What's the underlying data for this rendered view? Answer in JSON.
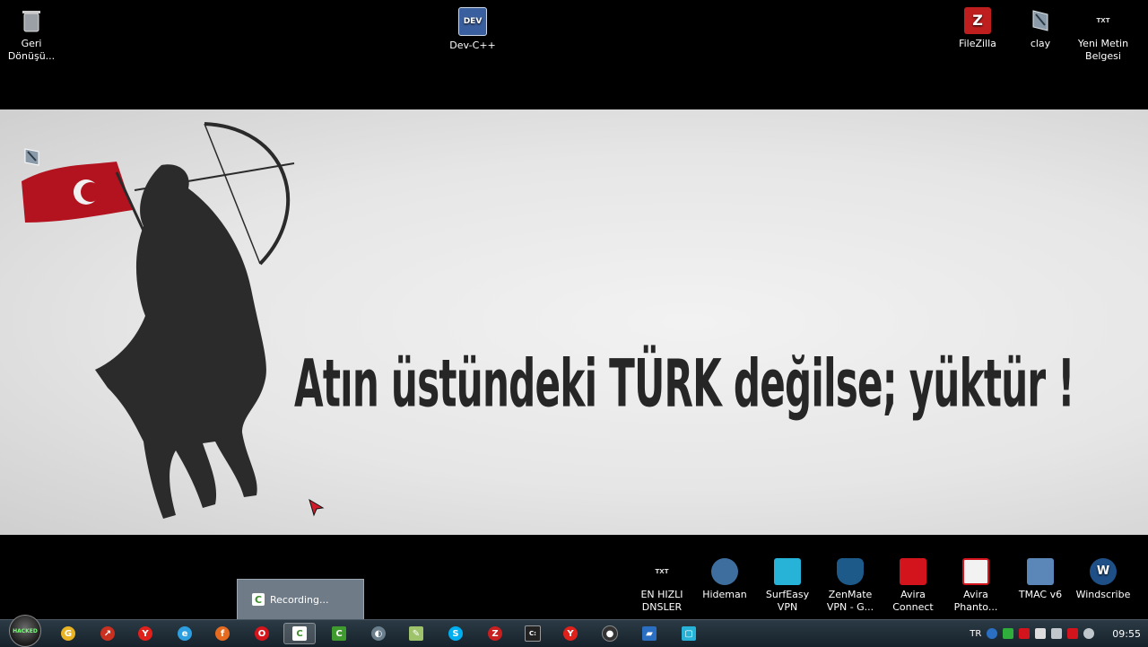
{
  "desktop_top_icons": [
    {
      "name": "recycle-bin",
      "label": "Geri\nDönüşü...",
      "icon": "trash-icon",
      "color": "#9aa0a6"
    },
    {
      "name": "dev-cpp",
      "label": "Dev-C++",
      "icon": "devcpp-icon",
      "color": "#3a5f9e",
      "glyph": "DEV"
    },
    {
      "name": "filezilla",
      "label": "FileZilla",
      "icon": "filezilla-icon",
      "color": "#bf1e1e",
      "glyph": "Z"
    },
    {
      "name": "clay",
      "label": "clay",
      "icon": "file-icon",
      "color": "#8a9aa8"
    },
    {
      "name": "yeni-metin-belgesi",
      "label": "Yeni Metin\nBelgesi",
      "icon": "text-file-icon",
      "color": "#e8e8e8",
      "glyph": "TXT"
    }
  ],
  "banner": {
    "slogan": "Atın üstündeki TÜRK değilse; yüktür !"
  },
  "desktop_bottom_icons": [
    {
      "name": "en-hizli-dnsler",
      "label": "EN HIZLI\nDNSLER",
      "icon": "text-file-icon",
      "color": "#d9d9d9",
      "glyph": "TXT"
    },
    {
      "name": "hideman",
      "label": "Hideman",
      "icon": "hideman-icon",
      "color": "#3d6e9e"
    },
    {
      "name": "surfeasy-vpn",
      "label": "SurfEasy VPN",
      "icon": "surfeasy-icon",
      "color": "#27b3d8"
    },
    {
      "name": "zenmate-vpn",
      "label": "ZenMate\nVPN - G...",
      "icon": "zenmate-icon",
      "color": "#1d5a8a"
    },
    {
      "name": "avira-connect",
      "label": "Avira\nConnect",
      "icon": "avira-icon",
      "color": "#d3141c"
    },
    {
      "name": "avira-phantom",
      "label": "Avira\nPhanto...",
      "icon": "avira-phantom-icon",
      "color": "#f2f2f2"
    },
    {
      "name": "tmac-v6",
      "label": "TMAC v6",
      "icon": "tmac-icon",
      "color": "#5a86b8"
    },
    {
      "name": "windscribe",
      "label": "Windscribe",
      "icon": "windscribe-icon",
      "color": "#1e4f86",
      "glyph": "W"
    }
  ],
  "recording_popup": {
    "label": "Recording..."
  },
  "taskbar": {
    "start_label": "HACKED",
    "apps": [
      {
        "name": "chrome",
        "color": "#e9b323",
        "glyph": "G"
      },
      {
        "name": "app-red",
        "color": "#c9301f",
        "glyph": "↗"
      },
      {
        "name": "yandex",
        "color": "#e0201b",
        "glyph": "Y"
      },
      {
        "name": "ie",
        "color": "#2d9fe0",
        "glyph": "e"
      },
      {
        "name": "firefox",
        "color": "#e66b1f",
        "glyph": "f"
      },
      {
        "name": "opera",
        "color": "#d6141c",
        "glyph": "O"
      },
      {
        "name": "camtasia-active",
        "color": "#ffffff",
        "glyph": "C",
        "active": true
      },
      {
        "name": "camtasia",
        "color": "#3f9b2e",
        "glyph": "C"
      },
      {
        "name": "steam",
        "color": "#6a7e8c",
        "glyph": "◐"
      },
      {
        "name": "notepad",
        "color": "#9ec36a",
        "glyph": "✎"
      },
      {
        "name": "skype",
        "color": "#00aff0",
        "glyph": "S"
      },
      {
        "name": "filezilla-task",
        "color": "#c81f1f",
        "glyph": "Z"
      },
      {
        "name": "cmd",
        "color": "#222222",
        "glyph": "C:"
      },
      {
        "name": "yandex-2",
        "color": "#e0201b",
        "glyph": "Y"
      },
      {
        "name": "app-dark",
        "color": "#333333",
        "glyph": "●"
      },
      {
        "name": "app-blue",
        "color": "#2a6fc2",
        "glyph": "▰"
      },
      {
        "name": "app-cyan",
        "color": "#27b3d8",
        "glyph": "▢"
      }
    ],
    "tray_lang": "TR",
    "clock": "09:55"
  }
}
